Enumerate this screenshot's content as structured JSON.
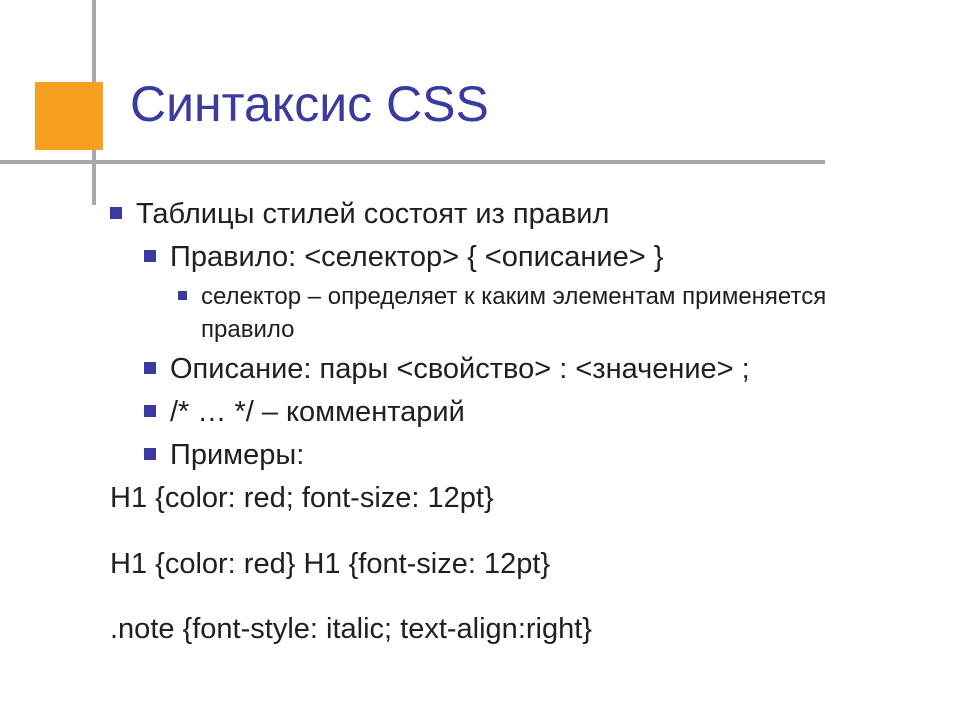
{
  "title": "Синтаксис CSS",
  "lines": {
    "intro": "Таблицы стилей состоят из правил",
    "rule": "Правило: <селектор> { <описание> }",
    "selector": "селектор – определяет к каким элементам применяется правило",
    "description": "Описание: пары <свойство> : <значение> ;",
    "comment": "/* … */ – комментарий",
    "examples_label": "Примеры:"
  },
  "examples": {
    "e1": "H1 {color: red; font-size: 12pt}",
    "e2": "H1 {color: red} H1 {font-size: 12pt}",
    "e3": ".note {font-style: italic; text-align:right}"
  }
}
